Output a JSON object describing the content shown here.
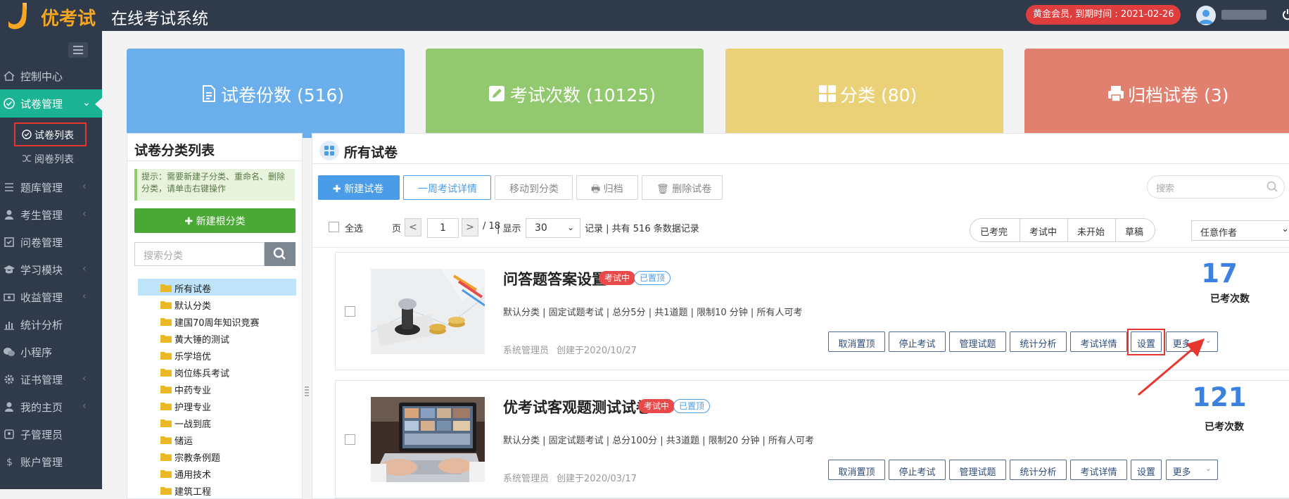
{
  "header": {
    "logo_text": "优考试",
    "app_title": "在线考试系统",
    "membership": "黄金会员, 到期时间 : 2021-02-26",
    "colors": {
      "bar": "#2f3a4a",
      "accent": "#1ab394",
      "logo": "#f5a623"
    }
  },
  "sidebar": {
    "items": [
      {
        "label": "控制中心",
        "icon": "home-icon"
      },
      {
        "label": "试卷管理",
        "icon": "check-circle-icon",
        "active": true
      },
      {
        "label": "题库管理",
        "icon": "list-icon"
      },
      {
        "label": "考生管理",
        "icon": "user-icon"
      },
      {
        "label": "问卷管理",
        "icon": "checkbox-icon"
      },
      {
        "label": "学习模块",
        "icon": "graduation-cap-icon"
      },
      {
        "label": "收益管理",
        "icon": "money-icon"
      },
      {
        "label": "统计分析",
        "icon": "bar-chart-icon"
      },
      {
        "label": "小程序",
        "icon": "wechat-icon"
      },
      {
        "label": "证书管理",
        "icon": "gear-icon"
      },
      {
        "label": "我的主页",
        "icon": "user-icon"
      },
      {
        "label": "子管理员",
        "icon": "admin-icon"
      },
      {
        "label": "账户管理",
        "icon": "dollar-icon"
      }
    ],
    "subitems": [
      {
        "label": "试卷列表",
        "icon": "check-circle-icon",
        "active": true
      },
      {
        "label": "阅卷列表",
        "icon": "shuffle-icon"
      }
    ]
  },
  "stats": [
    {
      "label": "试卷份数 (516)",
      "icon": "document-icon",
      "color": "#6aafeb"
    },
    {
      "label": "考试次数 (10125)",
      "icon": "edit-icon",
      "color": "#93c96e"
    },
    {
      "label": "分类 (80)",
      "icon": "grid-icon",
      "color": "#ead178"
    },
    {
      "label": "归档试卷 (3)",
      "icon": "printer-icon",
      "color": "#e2806f"
    }
  ],
  "categories": {
    "title": "试卷分类列表",
    "tip": "提示：需要新建子分类、重命名、删除分类，请单击右键操作",
    "new_button": "新建根分类",
    "search_placeholder": "搜索分类",
    "items": [
      "所有试卷",
      "默认分类",
      "建国70周年知识竞赛",
      "黄大锤的测试",
      "乐学培优",
      "岗位练兵考试",
      "中药专业",
      "护理专业",
      "一战到底",
      "储运",
      "宗教条例题",
      "通用技术",
      "建筑工程"
    ]
  },
  "main": {
    "title": "所有试卷",
    "toolbar": {
      "new_exam": "新建试卷",
      "week_details": "一周考试详情",
      "move_to_category": "移动到分类",
      "archive": "归档",
      "delete": "删除试卷",
      "search_placeholder": "搜索"
    },
    "pager": {
      "select_all": "全选",
      "page_label": "页",
      "prev": "<",
      "next": ">",
      "current_page": "1",
      "total_pages": "/ 18",
      "show_label": "| 显示",
      "page_size": "30",
      "records": "记录 | 共有 516 条数据记录"
    },
    "filters": [
      "已考完",
      "考试中",
      "未开始",
      "草稿"
    ],
    "author_filter": "任意作者"
  },
  "exams": [
    {
      "title": "问答题答案设置",
      "status": "考试中",
      "pinned": "已置顶",
      "meta": "默认分类 | 固定试题考试 | 总分5分 | 共1道题 | 限制10 分钟 | 所有人可考",
      "author": "系统管理员",
      "created": "创建于2020/10/27",
      "count": "17",
      "count_label": "已考次数",
      "thumb": "finance-photo"
    },
    {
      "title": "优考试客观题测试试卷",
      "status": "考试中",
      "pinned": "已置顶",
      "meta": "默认分类 | 固定试题考试 | 总分100分 | 共3道题 | 限制20 分钟 | 所有人可考",
      "author": "系统管理员",
      "created": "创建于2020/03/17",
      "count": "121",
      "count_label": "已考次数",
      "thumb": "laptop-photo"
    }
  ],
  "actions": [
    "取消置顶",
    "停止考试",
    "管理试题",
    "统计分析",
    "考试详情",
    "设置",
    "更多"
  ]
}
